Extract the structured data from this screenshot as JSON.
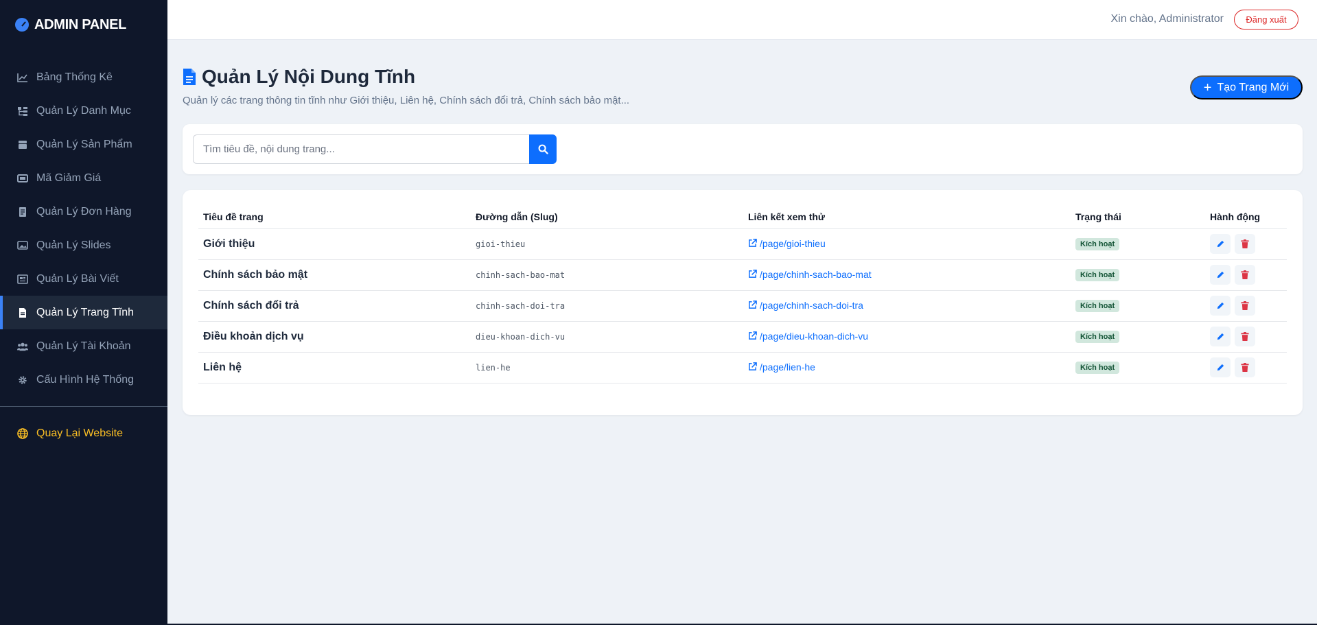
{
  "brand": {
    "title": "ADMIN PANEL"
  },
  "sidebar": {
    "items": [
      {
        "label": "Bảng Thống Kê",
        "icon": "chart-line-icon"
      },
      {
        "label": "Quản Lý Danh Mục",
        "icon": "sitemap-icon"
      },
      {
        "label": "Quản Lý Sản Phẩm",
        "icon": "box-icon"
      },
      {
        "label": "Mã Giảm Giá",
        "icon": "ticket-icon"
      },
      {
        "label": "Quản Lý Đơn Hàng",
        "icon": "receipt-icon"
      },
      {
        "label": "Quản Lý Slides",
        "icon": "images-icon"
      },
      {
        "label": "Quản Lý Bài Viết",
        "icon": "newspaper-icon"
      },
      {
        "label": "Quản Lý Trang Tĩnh",
        "icon": "file-icon"
      },
      {
        "label": "Quản Lý Tài Khoản",
        "icon": "users-icon"
      },
      {
        "label": "Cấu Hình Hệ Thống",
        "icon": "gear-icon"
      }
    ],
    "active_index": 7,
    "back_link": "Quay Lại Website"
  },
  "topbar": {
    "greeting": "Xin chào, Administrator",
    "logout": "Đăng xuất"
  },
  "page": {
    "title": "Quản Lý Nội Dung Tĩnh",
    "subtitle": "Quản lý các trang thông tin tĩnh như Giới thiệu, Liên hệ, Chính sách đổi trả, Chính sách bảo mật...",
    "create_button": "Tạo Trang Mới"
  },
  "search": {
    "placeholder": "Tìm tiêu đề, nội dung trang...",
    "value": ""
  },
  "table": {
    "headers": [
      "Tiêu đề trang",
      "Đường dẫn (Slug)",
      "Liên kết xem thử",
      "Trạng thái",
      "Hành động"
    ],
    "rows": [
      {
        "title": "Giới thiệu",
        "slug": "gioi-thieu",
        "link": "/page/gioi-thieu",
        "status": "Kích hoạt"
      },
      {
        "title": "Chính sách bảo mật",
        "slug": "chinh-sach-bao-mat",
        "link": "/page/chinh-sach-bao-mat",
        "status": "Kích hoạt"
      },
      {
        "title": "Chính sách đổi trả",
        "slug": "chinh-sach-doi-tra",
        "link": "/page/chinh-sach-doi-tra",
        "status": "Kích hoạt"
      },
      {
        "title": "Điều khoản dịch vụ",
        "slug": "dieu-khoan-dich-vu",
        "link": "/page/dieu-khoan-dich-vu",
        "status": "Kích hoạt"
      },
      {
        "title": "Liên hệ",
        "slug": "lien-he",
        "link": "/page/lien-he",
        "status": "Kích hoạt"
      }
    ]
  },
  "colors": {
    "sidebar_bg": "#0f172a",
    "primary": "#0d6efd",
    "danger": "#dc2626",
    "accent_yellow": "#fbbf24",
    "success_badge": "#d1e7dd"
  }
}
